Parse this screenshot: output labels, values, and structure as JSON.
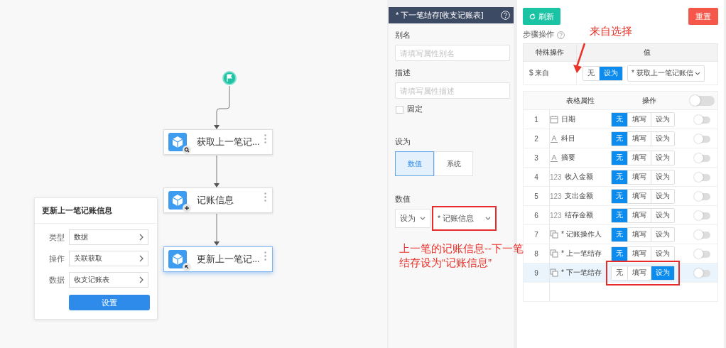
{
  "canvas": {
    "nodes": [
      {
        "label": "获取上一笔记...",
        "kind": "search",
        "selected": false
      },
      {
        "label": "记账信息",
        "kind": "plus",
        "selected": false
      },
      {
        "label": "更新上一笔记...",
        "kind": "cursor",
        "selected": true
      }
    ],
    "popover": {
      "title": "更新上一笔记账信息",
      "fields": [
        {
          "label": "类型",
          "value": "数据"
        },
        {
          "label": "操作",
          "value": "关联获取"
        },
        {
          "label": "数据",
          "value": "收支记账表"
        }
      ],
      "button": "设置"
    }
  },
  "property_panel": {
    "title": "* 下一笔结存[收支记账表]",
    "alias": {
      "label": "别名",
      "placeholder": "请填写属性别名"
    },
    "description": {
      "label": "描述",
      "placeholder": "请填写属性描述"
    },
    "fixed": {
      "label": "固定",
      "checked": false
    },
    "set_as": {
      "label": "设为",
      "options": [
        {
          "label": "数值",
          "selected": true
        },
        {
          "label": "系统",
          "selected": false
        }
      ]
    },
    "value": {
      "label": "数值",
      "mode": "设为",
      "selection": "* 记账信息",
      "highlighted": true
    }
  },
  "step_panel": {
    "refresh": "刷新",
    "reset": "重置",
    "step_title": "步骤操作",
    "special_table": {
      "columns": [
        "特殊操作",
        "值"
      ],
      "rows": [
        {
          "name": "$ 来自",
          "options": [
            {
              "label": "无",
              "selected": false
            },
            {
              "label": "设为",
              "selected": true
            }
          ],
          "value": "* 获取上一笔记账信"
        }
      ]
    },
    "attr_table": {
      "columns": [
        "表格属性",
        "操作"
      ],
      "header_toggle_on": false,
      "rows": [
        {
          "index": "1",
          "kind": "date",
          "name": "日期",
          "options": [
            {
              "label": "无",
              "selected": true
            },
            {
              "label": "填写",
              "selected": false
            },
            {
              "label": "设为",
              "selected": false
            }
          ],
          "toggle_on": false,
          "selected": false,
          "highlighted": false
        },
        {
          "index": "2",
          "kind": "text",
          "name": "科目",
          "options": [
            {
              "label": "无",
              "selected": true
            },
            {
              "label": "填写",
              "selected": false
            },
            {
              "label": "设为",
              "selected": false
            }
          ],
          "toggle_on": false,
          "selected": false,
          "highlighted": false
        },
        {
          "index": "3",
          "kind": "text",
          "name": "摘要",
          "options": [
            {
              "label": "无",
              "selected": true
            },
            {
              "label": "填写",
              "selected": false
            },
            {
              "label": "设为",
              "selected": false
            }
          ],
          "toggle_on": false,
          "selected": false,
          "highlighted": false
        },
        {
          "index": "4",
          "kind": "number",
          "type_text": "123",
          "name": "收入金额",
          "options": [
            {
              "label": "无",
              "selected": true
            },
            {
              "label": "填写",
              "selected": false
            },
            {
              "label": "设为",
              "selected": false
            }
          ],
          "toggle_on": false,
          "selected": false,
          "highlighted": false
        },
        {
          "index": "5",
          "kind": "number",
          "type_text": "123",
          "name": "支出金额",
          "options": [
            {
              "label": "无",
              "selected": true
            },
            {
              "label": "填写",
              "selected": false
            },
            {
              "label": "设为",
              "selected": false
            }
          ],
          "toggle_on": false,
          "selected": false,
          "highlighted": false
        },
        {
          "index": "6",
          "kind": "number",
          "type_text": "123",
          "name": "结存金额",
          "options": [
            {
              "label": "无",
              "selected": true
            },
            {
              "label": "填写",
              "selected": false
            },
            {
              "label": "设为",
              "selected": false
            }
          ],
          "toggle_on": false,
          "selected": false,
          "highlighted": false
        },
        {
          "index": "7",
          "kind": "relation",
          "name": "* 记账操作人",
          "options": [
            {
              "label": "无",
              "selected": true
            },
            {
              "label": "填写",
              "selected": false
            },
            {
              "label": "设为",
              "selected": false
            }
          ],
          "toggle_on": false,
          "selected": false,
          "highlighted": false
        },
        {
          "index": "8",
          "kind": "relation",
          "name": "* 上一笔结存",
          "options": [
            {
              "label": "无",
              "selected": true
            },
            {
              "label": "填写",
              "selected": false
            },
            {
              "label": "设为",
              "selected": false
            }
          ],
          "toggle_on": false,
          "selected": false,
          "highlighted": false
        },
        {
          "index": "9",
          "kind": "relation",
          "name": "* 下一笔结存",
          "options": [
            {
              "label": "无",
              "selected": false
            },
            {
              "label": "填写",
              "selected": false
            },
            {
              "label": "设为",
              "selected": true
            }
          ],
          "toggle_on": false,
          "selected": true,
          "highlighted": true
        }
      ]
    }
  },
  "annotations": [
    {
      "kind": "label",
      "lines": [
        "来自选择"
      ]
    },
    {
      "kind": "arrow"
    },
    {
      "kind": "label",
      "lines": [
        "上一笔的记账信息--下一笔",
        "结存设为“记账信息”"
      ]
    }
  ]
}
